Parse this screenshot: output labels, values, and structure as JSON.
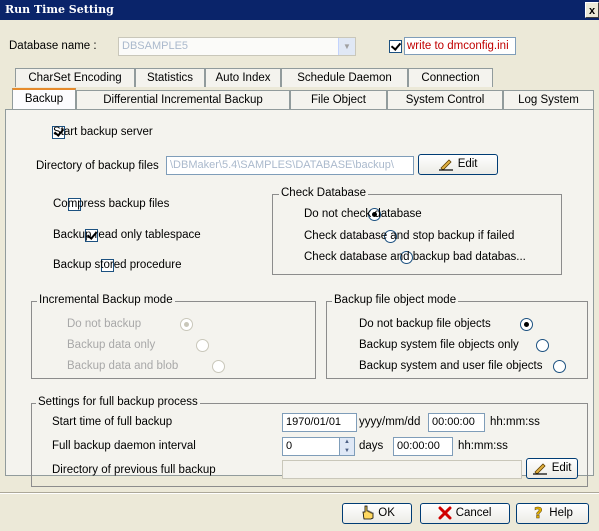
{
  "window": {
    "title": "Run Time Setting",
    "close": "x"
  },
  "header": {
    "db_label": "Database name :",
    "db_value": "DBSAMPLE5",
    "write_label": "write to dmconfig.ini",
    "write_checked": true
  },
  "tabs_row1": [
    "CharSet Encoding",
    "Statistics",
    "Auto Index",
    "Schedule Daemon",
    "Connection"
  ],
  "tabs_row2": [
    "Backup",
    "Differential Incremental Backup",
    "File Object",
    "System Control",
    "Log System"
  ],
  "active_tab": "Backup",
  "backup": {
    "start_backup_server": {
      "label": "Start backup server",
      "checked": true
    },
    "dir_label": "Directory of backup files",
    "dir_value": "\\DBMaker\\5.4\\SAMPLES\\DATABASE\\backup\\",
    "edit_label": "Edit",
    "compress": {
      "label": "Compress backup files",
      "checked": false
    },
    "readonly_ts": {
      "label": "Backup read only tablespace",
      "checked": true
    },
    "stored_proc": {
      "label": "Backup stored procedure",
      "checked": false
    },
    "check_db": {
      "title": "Check Database",
      "options": [
        "Do not check database",
        "Check database and stop backup if failed",
        "Check database and backup bad databas..."
      ],
      "selected": 0
    },
    "incremental": {
      "title": "Incremental Backup mode",
      "options": [
        "Do not backup",
        "Backup data only",
        "Backup data and blob"
      ],
      "selected": 0,
      "disabled": true
    },
    "file_object": {
      "title": "Backup file object mode",
      "options": [
        "Do not backup file objects",
        "Backup system file objects only",
        "Backup system and user file objects"
      ],
      "selected": 0
    },
    "full": {
      "title": "Settings for full backup process",
      "start_label": "Start time of full backup",
      "start_date": "1970/01/01",
      "date_fmt": "yyyy/mm/dd",
      "start_time": "00:00:00",
      "time_fmt": "hh:mm:ss",
      "interval_label": "Full backup daemon interval",
      "interval_days": "0",
      "days_label": "days",
      "interval_time": "00:00:00",
      "interval_fmt": "hh:mm:ss",
      "prev_label": "Directory of previous full backup",
      "prev_value": "",
      "edit_label": "Edit"
    }
  },
  "buttons": {
    "ok": "OK",
    "cancel": "Cancel",
    "help": "Help"
  },
  "icons": {
    "edit": "pencil-icon",
    "ok": "hand-icon",
    "cancel": "x-icon",
    "help": "question-icon"
  }
}
